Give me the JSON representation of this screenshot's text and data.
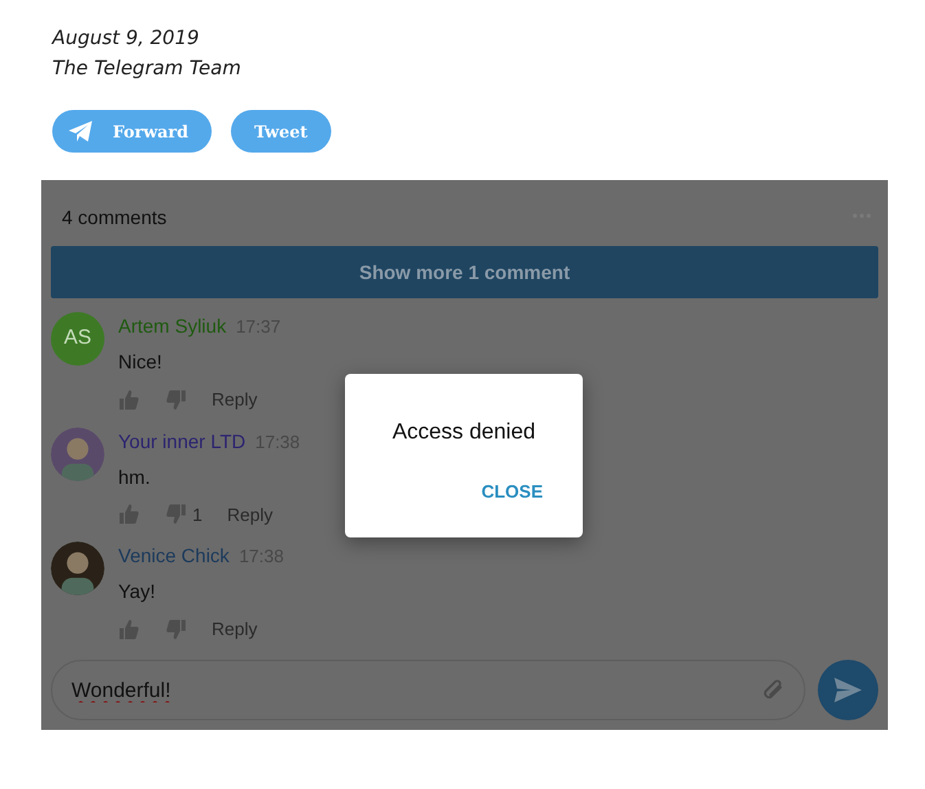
{
  "post": {
    "date": "August 9, 2019",
    "author": "The Telegram Team"
  },
  "share_buttons": [
    {
      "kind": "telegram",
      "label": "Forward"
    },
    {
      "kind": "plain",
      "label": "Tweet"
    }
  ],
  "comments_widget": {
    "count": "4 comments",
    "show_more": "Show more 1 comment",
    "comments": [
      {
        "author": "Artem Syliuk",
        "color": "#1f5a10",
        "time": "17:37",
        "text": "Nice!",
        "avatar": {
          "kind": "initials",
          "initials": "AS",
          "color": "#3e7a26"
        },
        "reply": "Reply"
      },
      {
        "author": "Your inner LTD",
        "color": "#2c2470",
        "time": "17:38",
        "text": "hm.",
        "dislikes": "1",
        "reply": "Reply"
      },
      {
        "author": "Venice Chick",
        "color": "#1c3a5c",
        "time": "17:38",
        "text": "Yay!",
        "reply": "Reply"
      }
    ],
    "input": {
      "value": "Wonderful!"
    }
  },
  "dialog": {
    "message": "Access denied",
    "button": "CLOSE"
  }
}
